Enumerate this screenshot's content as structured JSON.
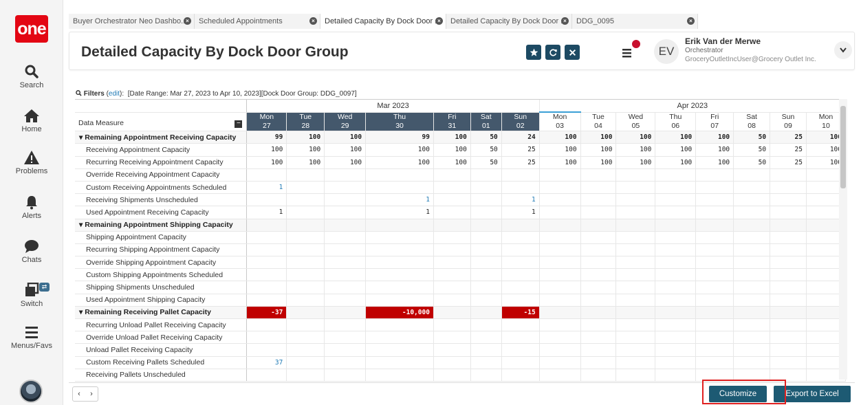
{
  "sidebar": {
    "logo": "one",
    "items": [
      {
        "label": "Search",
        "icon": "search-icon"
      },
      {
        "label": "Home",
        "icon": "home-icon"
      },
      {
        "label": "Problems",
        "icon": "warning-icon"
      },
      {
        "label": "Alerts",
        "icon": "bell-icon"
      },
      {
        "label": "Chats",
        "icon": "chat-icon"
      },
      {
        "label": "Switch",
        "icon": "switch-icon"
      },
      {
        "label": "Menus/Favs",
        "icon": "hamburger-icon"
      }
    ]
  },
  "tabs": [
    {
      "label": "Buyer Orchestrator Neo Dashbo...",
      "active": false
    },
    {
      "label": "Scheduled Appointments",
      "active": false
    },
    {
      "label": "Detailed Capacity By Dock Door ...",
      "active": true
    },
    {
      "label": "Detailed Capacity By Dock Door ...",
      "active": false
    },
    {
      "label": "DDG_0095",
      "active": false
    }
  ],
  "header": {
    "title": "Detailed Capacity By Dock Door Group",
    "user": {
      "initials": "EV",
      "name": "Erik Van der Merwe",
      "role": "Orchestrator",
      "email": "GroceryOutletIncUser@Grocery Outlet Inc."
    }
  },
  "filters": {
    "label": "Filters",
    "edit": "edit",
    "text": "[Date Range: Mar 27, 2023 to Apr 10, 2023][Dock Door Group: DDG_0097]"
  },
  "grid": {
    "measure_header": "Data Measure",
    "months": [
      {
        "label": "Mar 2023",
        "span": 7
      },
      {
        "label": "Apr 2023",
        "span": 8
      }
    ],
    "days": [
      {
        "dow": "Mon",
        "day": "27"
      },
      {
        "dow": "Tue",
        "day": "28"
      },
      {
        "dow": "Wed",
        "day": "29"
      },
      {
        "dow": "Thu",
        "day": "30"
      },
      {
        "dow": "Fri",
        "day": "31"
      },
      {
        "dow": "Sat",
        "day": "01"
      },
      {
        "dow": "Sun",
        "day": "02"
      },
      {
        "dow": "Mon",
        "day": "03"
      },
      {
        "dow": "Tue",
        "day": "04"
      },
      {
        "dow": "Wed",
        "day": "05"
      },
      {
        "dow": "Thu",
        "day": "06"
      },
      {
        "dow": "Fri",
        "day": "07"
      },
      {
        "dow": "Sat",
        "day": "08"
      },
      {
        "dow": "Sun",
        "day": "09"
      },
      {
        "dow": "Mon",
        "day": "10"
      }
    ],
    "rows": [
      {
        "label": "Remaining Appointment Receiving Capacity",
        "group": true,
        "values": [
          "99",
          "100",
          "100",
          "99",
          "100",
          "50",
          "24",
          "100",
          "100",
          "100",
          "100",
          "100",
          "50",
          "25",
          "100"
        ]
      },
      {
        "label": "Receiving Appointment Capacity",
        "values": [
          "100",
          "100",
          "100",
          "100",
          "100",
          "50",
          "25",
          "100",
          "100",
          "100",
          "100",
          "100",
          "50",
          "25",
          "100"
        ]
      },
      {
        "label": "Recurring Receiving Appointment Capacity",
        "values": [
          "100",
          "100",
          "100",
          "100",
          "100",
          "50",
          "25",
          "100",
          "100",
          "100",
          "100",
          "100",
          "50",
          "25",
          "100"
        ]
      },
      {
        "label": "Override Receiving Appointment Capacity",
        "values": [
          "",
          "",
          "",
          "",
          "",
          "",
          "",
          "",
          "",
          "",
          "",
          "",
          "",
          "",
          ""
        ]
      },
      {
        "label": "Custom Receiving Appointments Scheduled",
        "values": [
          "1",
          "",
          "",
          "",
          "",
          "",
          "",
          "",
          "",
          "",
          "",
          "",
          "",
          "",
          ""
        ],
        "blue": [
          0
        ]
      },
      {
        "label": "Receiving Shipments Unscheduled",
        "values": [
          "",
          "",
          "",
          "1",
          "",
          "",
          "1",
          "",
          "",
          "",
          "",
          "",
          "",
          "",
          ""
        ],
        "blue": [
          3,
          6
        ]
      },
      {
        "label": "Used Appointment Receiving Capacity",
        "values": [
          "1",
          "",
          "",
          "1",
          "",
          "",
          "1",
          "",
          "",
          "",
          "",
          "",
          "",
          "",
          ""
        ]
      },
      {
        "label": "Remaining Appointment Shipping Capacity",
        "group": true,
        "values": [
          "",
          "",
          "",
          "",
          "",
          "",
          "",
          "",
          "",
          "",
          "",
          "",
          "",
          "",
          ""
        ]
      },
      {
        "label": "Shipping Appointment Capacity",
        "values": [
          "",
          "",
          "",
          "",
          "",
          "",
          "",
          "",
          "",
          "",
          "",
          "",
          "",
          "",
          ""
        ]
      },
      {
        "label": "Recurring Shipping Appointment Capacity",
        "values": [
          "",
          "",
          "",
          "",
          "",
          "",
          "",
          "",
          "",
          "",
          "",
          "",
          "",
          "",
          ""
        ]
      },
      {
        "label": "Override Shipping Appointment Capacity",
        "values": [
          "",
          "",
          "",
          "",
          "",
          "",
          "",
          "",
          "",
          "",
          "",
          "",
          "",
          "",
          ""
        ]
      },
      {
        "label": "Custom Shipping Appointments Scheduled",
        "values": [
          "",
          "",
          "",
          "",
          "",
          "",
          "",
          "",
          "",
          "",
          "",
          "",
          "",
          "",
          ""
        ]
      },
      {
        "label": "Shipping Shipments Unscheduled",
        "values": [
          "",
          "",
          "",
          "",
          "",
          "",
          "",
          "",
          "",
          "",
          "",
          "",
          "",
          "",
          ""
        ]
      },
      {
        "label": "Used Appointment Shipping Capacity",
        "values": [
          "",
          "",
          "",
          "",
          "",
          "",
          "",
          "",
          "",
          "",
          "",
          "",
          "",
          "",
          ""
        ]
      },
      {
        "label": "Remaining Receiving Pallet Capacity",
        "group": true,
        "values": [
          "-37",
          "",
          "",
          "-10,000",
          "",
          "",
          "-15",
          "",
          "",
          "",
          "",
          "",
          "",
          "",
          ""
        ],
        "neg": [
          0,
          3,
          6
        ]
      },
      {
        "label": "Recurring Unload Pallet Receiving Capacity",
        "values": [
          "",
          "",
          "",
          "",
          "",
          "",
          "",
          "",
          "",
          "",
          "",
          "",
          "",
          "",
          ""
        ]
      },
      {
        "label": "Override Unload Pallet Receiving Capacity",
        "values": [
          "",
          "",
          "",
          "",
          "",
          "",
          "",
          "",
          "",
          "",
          "",
          "",
          "",
          "",
          ""
        ]
      },
      {
        "label": "Unload Pallet Receiving Capacity",
        "values": [
          "",
          "",
          "",
          "",
          "",
          "",
          "",
          "",
          "",
          "",
          "",
          "",
          "",
          "",
          ""
        ]
      },
      {
        "label": "Custom Receiving Pallets Scheduled",
        "values": [
          "37",
          "",
          "",
          "",
          "",
          "",
          "",
          "",
          "",
          "",
          "",
          "",
          "",
          "",
          ""
        ],
        "blue": [
          0
        ]
      },
      {
        "label": "Receiving Pallets Unscheduled",
        "values": [
          "",
          "",
          "",
          "",
          "",
          "",
          "",
          "",
          "",
          "",
          "",
          "",
          "",
          "",
          ""
        ]
      }
    ]
  },
  "footer": {
    "customize": "Customize",
    "export": "Export to Excel"
  },
  "colors": {
    "brand_red": "#e30613",
    "header_dark": "#44586c",
    "button_teal": "#1d5a73",
    "negative_red": "#c00000",
    "link_blue": "#1f7ab5"
  }
}
